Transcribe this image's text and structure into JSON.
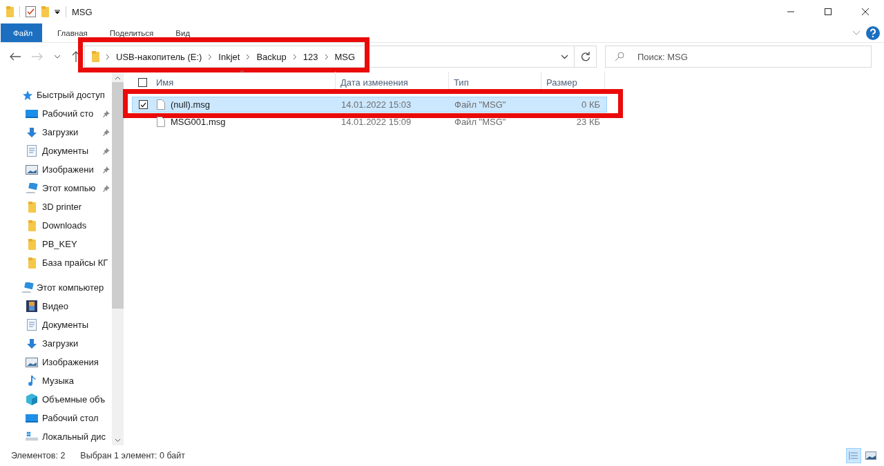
{
  "window": {
    "title": "MSG"
  },
  "ribbon": {
    "tabs": [
      {
        "label": "Файл",
        "kind": "file"
      },
      {
        "label": "Главная",
        "kind": "tab"
      },
      {
        "label": "Поделиться",
        "kind": "tab"
      },
      {
        "label": "Вид",
        "kind": "tab"
      }
    ]
  },
  "address": {
    "highlighted": true,
    "forward_disabled": true,
    "path": [
      "USB-накопитель (E:)",
      "Inkjet",
      "Backup",
      "123",
      "MSG"
    ],
    "search": {
      "placeholder": "Поиск: MSG"
    }
  },
  "sidebar": {
    "groups": [
      {
        "label": "Быстрый доступ",
        "kind": "star",
        "items": [
          {
            "label": "Рабочий сто",
            "kind": "desktop",
            "pinned": true
          },
          {
            "label": "Загрузки",
            "kind": "download",
            "pinned": true
          },
          {
            "label": "Документы",
            "kind": "document",
            "pinned": true
          },
          {
            "label": "Изображени",
            "kind": "pictures",
            "pinned": true
          },
          {
            "label": "Этот компью",
            "kind": "computer",
            "pinned": true
          },
          {
            "label": "3D printer",
            "kind": "folder",
            "pinned": false
          },
          {
            "label": "Downloads",
            "kind": "folder",
            "pinned": false
          },
          {
            "label": "PB_KEY",
            "kind": "folder",
            "pinned": false
          },
          {
            "label": "База прайсы КГ",
            "kind": "folder",
            "pinned": false
          }
        ]
      },
      {
        "label": "Этот компьютер",
        "kind": "computer",
        "items": [
          {
            "label": "Видео",
            "kind": "video"
          },
          {
            "label": "Документы",
            "kind": "document"
          },
          {
            "label": "Загрузки",
            "kind": "download"
          },
          {
            "label": "Изображения",
            "kind": "pictures"
          },
          {
            "label": "Музыка",
            "kind": "music"
          },
          {
            "label": "Объемные объ",
            "kind": "objects"
          },
          {
            "label": "Рабочий стол",
            "kind": "desktop"
          },
          {
            "label": "Локальный дис",
            "kind": "drive"
          }
        ]
      }
    ]
  },
  "table": {
    "select_all_checked": false,
    "columns": [
      {
        "label": "Имя",
        "sorted": true
      },
      {
        "label": "Дата изменения",
        "sorted": false
      },
      {
        "label": "Тип",
        "sorted": false
      },
      {
        "label": "Размер",
        "sorted": false
      }
    ],
    "rows": [
      {
        "name": "(null).msg",
        "date": "14.01.2022 15:03",
        "type": "Файл \"MSG\"",
        "size": "0 КБ",
        "selected": true,
        "checked": true,
        "highlighted": true
      },
      {
        "name": "MSG001.msg",
        "date": "14.01.2022 15:09",
        "type": "Файл \"MSG\"",
        "size": "23 КБ",
        "selected": false,
        "checked": false,
        "highlighted": false
      }
    ]
  },
  "status_bar": {
    "count": "Элементов: 2",
    "selection": "Выбран 1 элемент: 0 байт",
    "views": [
      {
        "kind": "details",
        "selected": true
      },
      {
        "kind": "large",
        "selected": false
      }
    ]
  }
}
